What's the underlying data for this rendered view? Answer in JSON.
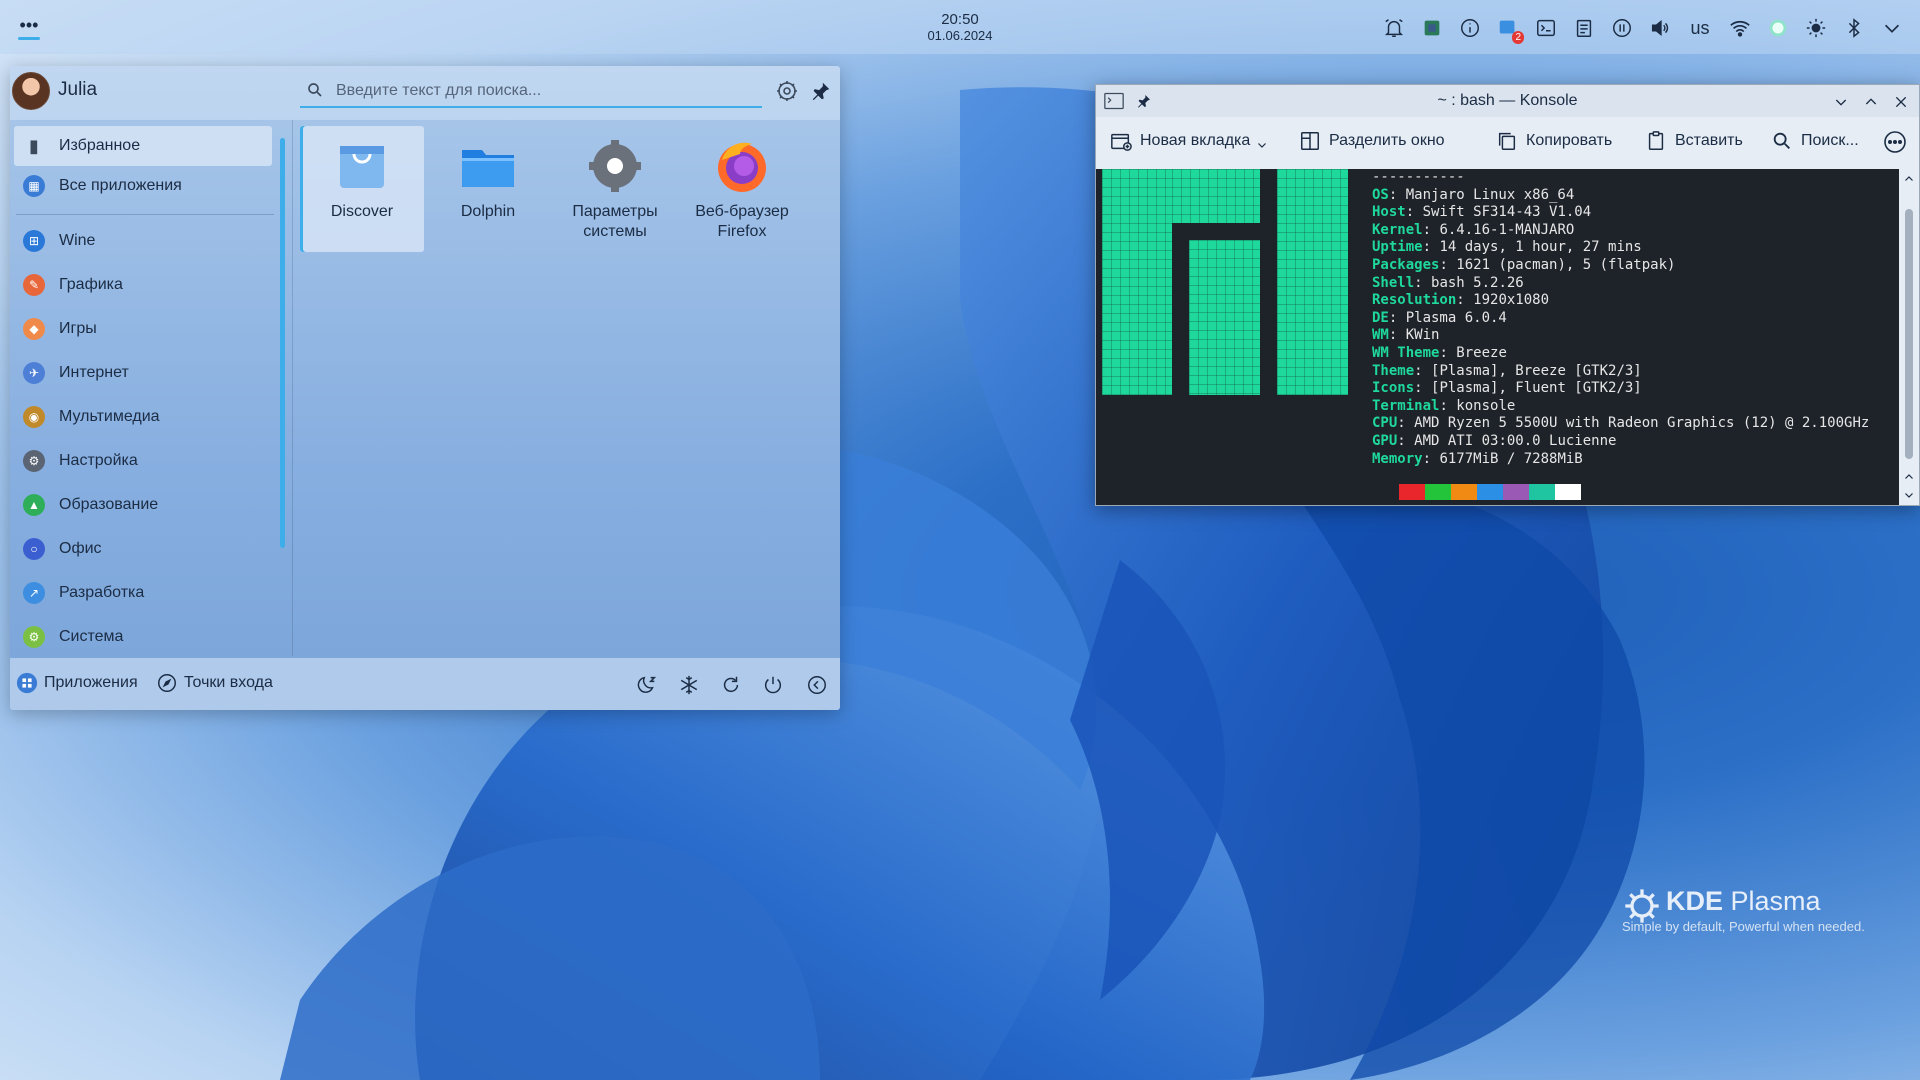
{
  "panel": {
    "time": "20:50",
    "date": "01.06.2024",
    "keyboard_layout": "us",
    "notification_badge": "2",
    "tray_icons": [
      "notifications-icon",
      "vault-icon",
      "info-icon",
      "updates-icon",
      "terminal-icon",
      "clipboard-icon",
      "media-pause-icon",
      "volume-icon",
      "keyboard-layout",
      "wifi-icon",
      "night-color-icon",
      "brightness-icon",
      "bluetooth-icon",
      "expand-tray-icon"
    ]
  },
  "launcher": {
    "user_name": "Julia",
    "search_placeholder": "Введите текст для поиска...",
    "sidebar": [
      {
        "label": "Избранное",
        "icon": "bookmark-icon",
        "color": "#3c4a5c"
      },
      {
        "label": "Все приложения",
        "icon": "grid-icon",
        "color": "#3a7bd5"
      },
      {
        "label": "Wine",
        "icon": "wine-icon",
        "color": "#2a79d8"
      },
      {
        "label": "Графика",
        "icon": "graphics-icon",
        "color": "#e8673a"
      },
      {
        "label": "Игры",
        "icon": "games-icon",
        "color": "#f08a4b"
      },
      {
        "label": "Интернет",
        "icon": "internet-icon",
        "color": "#4d7fd6"
      },
      {
        "label": "Мультимедиа",
        "icon": "multimedia-icon",
        "color": "#c08a2a"
      },
      {
        "label": "Настройка",
        "icon": "settings-icon",
        "color": "#5a6472"
      },
      {
        "label": "Образование",
        "icon": "education-icon",
        "color": "#2fae5a"
      },
      {
        "label": "Офис",
        "icon": "office-icon",
        "color": "#3b5fd0"
      },
      {
        "label": "Разработка",
        "icon": "development-icon",
        "color": "#3d8ee0"
      },
      {
        "label": "Система",
        "icon": "system-icon",
        "color": "#7bc043"
      }
    ],
    "favorites": [
      {
        "label": "Discover",
        "icon": "discover-icon"
      },
      {
        "label": "Dolphin",
        "icon": "dolphin-icon"
      },
      {
        "label": "Параметры системы",
        "icon": "system-settings-icon"
      },
      {
        "label": "Веб-браузер Firefox",
        "icon": "firefox-icon"
      }
    ],
    "footer": {
      "tab_apps": "Приложения",
      "tab_places": "Точки входа"
    }
  },
  "konsole": {
    "title": "~ : bash — Konsole",
    "toolbar": {
      "new_tab": "Новая вкладка",
      "split": "Разделить окно",
      "copy": "Копировать",
      "paste": "Вставить",
      "find": "Поиск..."
    },
    "separator": "-----------",
    "neofetch": [
      {
        "key": "OS",
        "value": "Manjaro Linux x86_64"
      },
      {
        "key": "Host",
        "value": "Swift SF314-43 V1.04"
      },
      {
        "key": "Kernel",
        "value": "6.4.16-1-MANJARO"
      },
      {
        "key": "Uptime",
        "value": "14 days, 1 hour, 27 mins"
      },
      {
        "key": "Packages",
        "value": "1621 (pacman), 5 (flatpak)"
      },
      {
        "key": "Shell",
        "value": "bash 5.2.26"
      },
      {
        "key": "Resolution",
        "value": "1920x1080"
      },
      {
        "key": "DE",
        "value": "Plasma 6.0.4"
      },
      {
        "key": "WM",
        "value": "KWin"
      },
      {
        "key": "WM Theme",
        "value": "Breeze"
      },
      {
        "key": "Theme",
        "value": "[Plasma], Breeze [GTK2/3]"
      },
      {
        "key": "Icons",
        "value": "[Plasma], Fluent [GTK2/3]"
      },
      {
        "key": "Terminal",
        "value": "konsole"
      },
      {
        "key": "CPU",
        "value": "AMD Ryzen 5 5500U with Radeon Graphics (12) @ 2.100GHz"
      },
      {
        "key": "GPU",
        "value": "AMD ATI 03:00.0 Lucienne"
      },
      {
        "key": "Memory",
        "value": "6177MiB / 7288MiB"
      }
    ],
    "palette": [
      "#e8262b",
      "#23c43a",
      "#f08a13",
      "#2b8fe6",
      "#9b59b6",
      "#1fc4a0",
      "#ffffff"
    ],
    "logo_color": "#1fd89c"
  },
  "watermark": {
    "brand_bold": "KDE",
    "brand_light": " Plasma",
    "slogan": "Simple by default, Powerful when  needed."
  }
}
